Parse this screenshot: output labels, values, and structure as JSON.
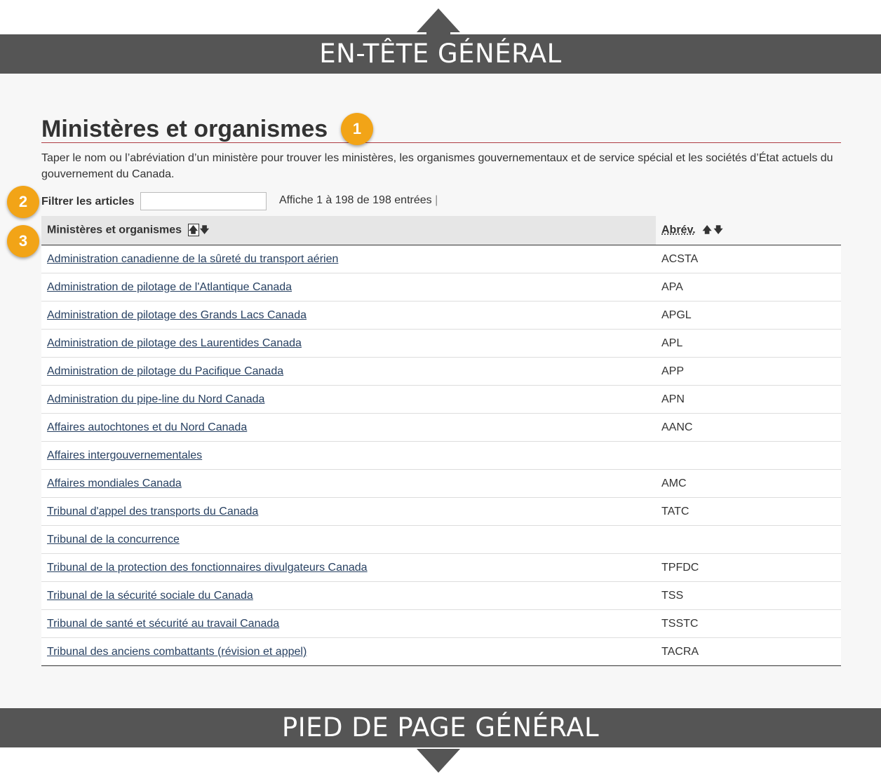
{
  "banners": {
    "header": "EN-TÊTE GÉNÉRAL",
    "footer": "PIED DE PAGE GÉNÉRAL"
  },
  "callouts": [
    "1",
    "2",
    "3"
  ],
  "page": {
    "title": "Ministères et organismes",
    "description": "Taper le nom ou l’abréviation d’un ministère pour trouver les ministères, les organismes gouvernementaux et de service spécial et les sociétés d’État actuels du gouvernement du Canada."
  },
  "filter": {
    "label": "Filtrer les articles",
    "value": "",
    "entries_text": "Affiche 1 à 198 de 198 entrées"
  },
  "table": {
    "headers": {
      "name": "Ministères et organismes",
      "abbr": "Abrév."
    },
    "rows": [
      {
        "name": "Administration canadienne de la sûreté du transport aérien",
        "abbr": "ACSTA"
      },
      {
        "name": "Administration de pilotage de l'Atlantique Canada",
        "abbr": "APA"
      },
      {
        "name": "Administration de pilotage des Grands Lacs Canada",
        "abbr": "APGL"
      },
      {
        "name": "Administration de pilotage des Laurentides Canada",
        "abbr": "APL"
      },
      {
        "name": "Administration de pilotage du Pacifique Canada",
        "abbr": "APP"
      },
      {
        "name": "Administration du pipe-line du Nord Canada",
        "abbr": "APN"
      },
      {
        "name": "Affaires autochtones et du Nord Canada",
        "abbr": "AANC"
      },
      {
        "name": "Affaires intergouvernementales",
        "abbr": ""
      },
      {
        "name": "Affaires mondiales Canada",
        "abbr": "AMC"
      },
      {
        "name": "Tribunal d'appel des transports du Canada",
        "abbr": "TATC"
      },
      {
        "name": "Tribunal de la concurrence",
        "abbr": ""
      },
      {
        "name": "Tribunal de la protection des fonctionnaires divulgateurs Canada",
        "abbr": "TPFDC"
      },
      {
        "name": "Tribunal de la sécurité sociale du Canada",
        "abbr": "TSS"
      },
      {
        "name": "Tribunal de santé et sécurité au travail Canada",
        "abbr": "TSSTC"
      },
      {
        "name": "Tribunal des anciens combattants (révision et appel)",
        "abbr": "TACRA"
      }
    ]
  },
  "icons": {
    "sort_up": "arrow-up-icon",
    "sort_down": "arrow-down-icon",
    "banner_up": "arrow-up-icon",
    "banner_down": "arrow-down-icon"
  },
  "colors": {
    "banner": "#555555",
    "badge": "#f2a417",
    "title_rule": "#af3c43",
    "link": "#284162"
  }
}
